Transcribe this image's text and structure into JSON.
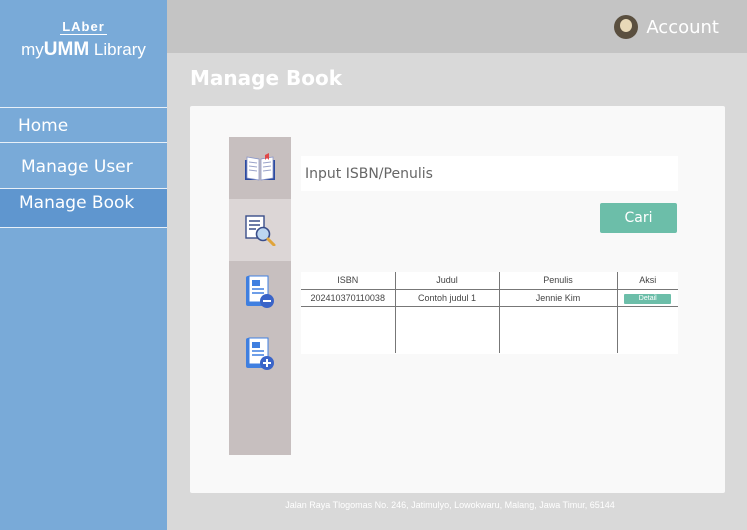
{
  "brand": {
    "top": "LAber",
    "prefix": "my",
    "bold": "UMM",
    "suffix": " Library"
  },
  "sidebar": {
    "items": [
      {
        "label": "Home"
      },
      {
        "label": "Manage User"
      },
      {
        "label": "Manage Book"
      }
    ]
  },
  "header": {
    "account": "Account"
  },
  "page": {
    "title": "Manage Book"
  },
  "toolbar": {
    "icons": [
      "open-book-icon",
      "search-document-icon",
      "remove-book-icon",
      "add-book-icon"
    ]
  },
  "search": {
    "placeholder": "Input ISBN/Penulis",
    "button": "Cari"
  },
  "table": {
    "headers": [
      "ISBN",
      "Judul",
      "Penulis",
      "Aksi"
    ],
    "rows": [
      {
        "isbn": "202410370110038",
        "judul": "Contoh judul 1",
        "penulis": "Jennie Kim",
        "aksi": "Detail"
      }
    ]
  },
  "footer": {
    "address": "Jalan Raya Tlogomas No. 246, Jatimulyo, Lowokwaru, Malang, Jawa Timur, 65144"
  },
  "colors": {
    "sidebar": "#79aad8",
    "sidebar_active": "#5f96cf",
    "accent": "#6cbea9",
    "topbar": "#c4c4c4",
    "background": "#d9d9d9"
  }
}
